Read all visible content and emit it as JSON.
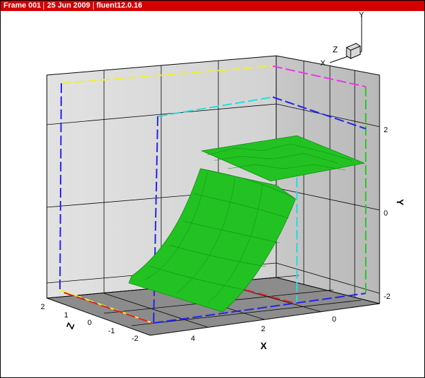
{
  "title_bar": {
    "frame": "Frame 001",
    "date": "25 Jun 2009",
    "source": "fluent12.0.16"
  },
  "axes": {
    "x": {
      "title": "X",
      "ticks": [
        "4",
        "2",
        "0"
      ]
    },
    "y": {
      "title": "Y",
      "ticks": [
        "2",
        "0",
        "-2"
      ]
    },
    "z": {
      "title": "Z",
      "ticks": [
        "2",
        "1",
        "0",
        "-1",
        "-2"
      ]
    }
  },
  "triad": {
    "x_label": "X",
    "y_label": "Y",
    "z_label": "Z"
  },
  "colors": {
    "title_bar": "#d40000",
    "back_walls": "#d8d8d8",
    "floor": "#8a8a8a",
    "surface": "#22c222",
    "surface_dark": "#0e8e0e",
    "edge_blue": "#2222ee",
    "edge_yellow": "#eeee33",
    "edge_magenta": "#ee33ee",
    "edge_cyan": "#22dddd",
    "edge_green": "#22cc22",
    "edge_red": "#dd2222"
  }
}
